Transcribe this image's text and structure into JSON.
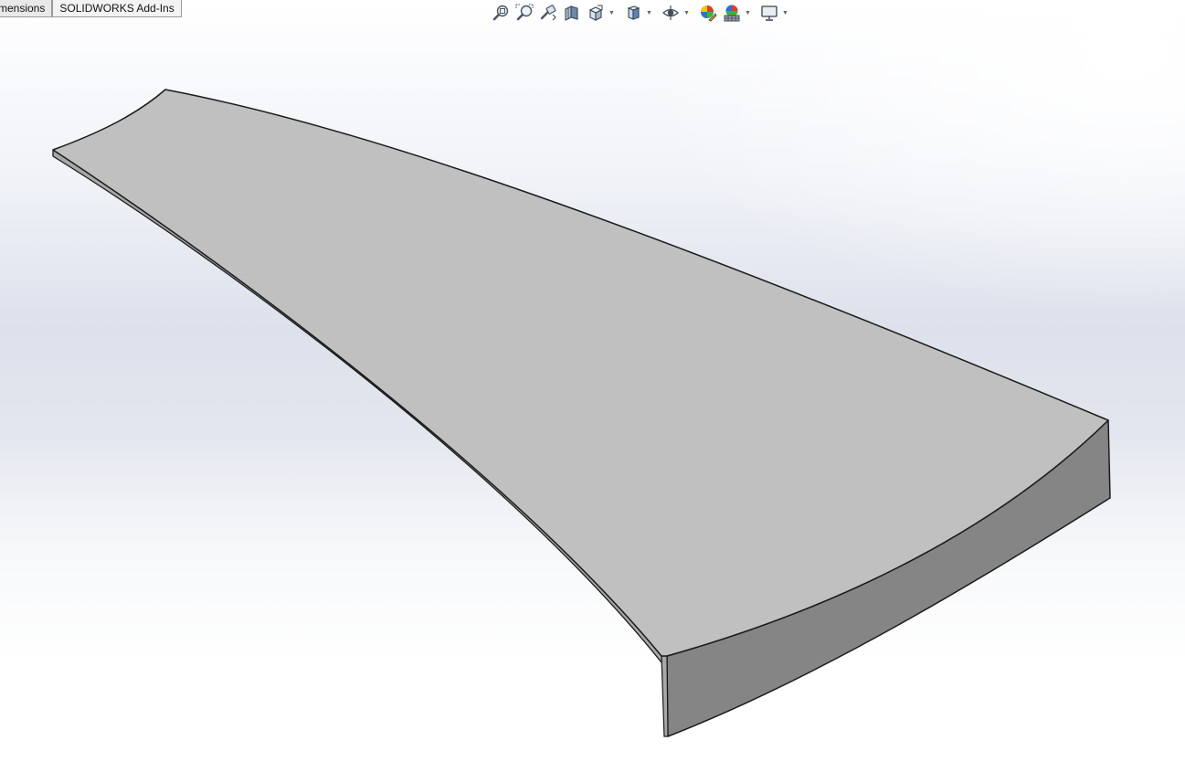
{
  "tabs": [
    {
      "label": "mensions"
    },
    {
      "label": "SOLIDWORKS Add-Ins"
    }
  ],
  "heads_up_toolbar": {
    "items": [
      {
        "icon": "zoom-to-fit-icon"
      },
      {
        "icon": "zoom-to-area-icon"
      },
      {
        "icon": "previous-view-icon"
      },
      {
        "icon": "section-view-icon"
      },
      {
        "icon": "view-orientation-icon",
        "dropdown": true
      },
      {
        "icon": "display-style-icon",
        "dropdown": true
      },
      {
        "icon": "hide-show-items-icon",
        "dropdown": true
      },
      {
        "icon": "edit-appearance-icon"
      },
      {
        "icon": "apply-scene-icon",
        "dropdown": true
      },
      {
        "icon": "view-settings-icon",
        "dropdown": true
      }
    ]
  },
  "model": {
    "top_face_color": "#c0c0c0",
    "front_face_color": "#858585",
    "side_face_color": "#a8a8a8",
    "edge_color": "#1a1a1a"
  }
}
